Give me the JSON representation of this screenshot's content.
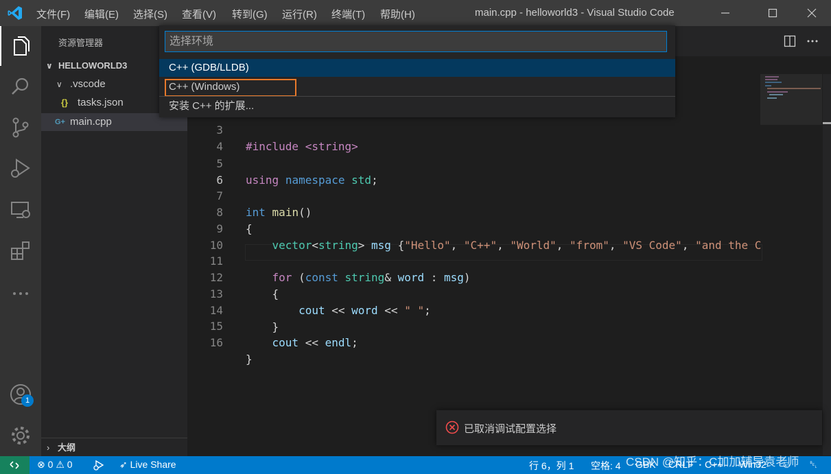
{
  "window": {
    "title": "main.cpp - helloworld3 - Visual Studio Code"
  },
  "menu": [
    {
      "label": "文件(F)"
    },
    {
      "label": "编辑(E)"
    },
    {
      "label": "选择(S)"
    },
    {
      "label": "查看(V)"
    },
    {
      "label": "转到(G)"
    },
    {
      "label": "运行(R)"
    },
    {
      "label": "终端(T)"
    },
    {
      "label": "帮助(H)"
    }
  ],
  "activity_bar": {
    "items": [
      "explorer-icon",
      "search-icon",
      "source-control-icon",
      "run-debug-icon",
      "remote-explorer-icon",
      "extensions-icon",
      "more-icon"
    ],
    "bottom": [
      "account-icon",
      "gear-icon"
    ],
    "account_badge": "1"
  },
  "sidebar": {
    "title": "资源管理器",
    "folder": "HELLOWORLD3",
    "items": [
      {
        "label": ".vscode",
        "icon": "chevron-down-icon"
      },
      {
        "label": "tasks.json",
        "icon": "json-braces-icon",
        "badge": "{}"
      },
      {
        "label": "main.cpp",
        "icon": "cpp-file-icon",
        "badge": "G+"
      }
    ],
    "outline": "大纲"
  },
  "quickpick": {
    "placeholder": "选择环境",
    "items": [
      {
        "label": "C++ (GDB/LLDB)"
      },
      {
        "label": "C++ (Windows)"
      },
      {
        "label": "安装 C++ 的扩展..."
      }
    ]
  },
  "editor": {
    "partial_line": {
      "num": "3",
      "text": "#include <string>"
    },
    "lines": [
      {
        "num": "4"
      },
      {
        "num": "5"
      },
      {
        "num": "6"
      },
      {
        "num": "7"
      },
      {
        "num": "8"
      },
      {
        "num": "9"
      },
      {
        "num": "10"
      },
      {
        "num": "11"
      },
      {
        "num": "12"
      },
      {
        "num": "13"
      },
      {
        "num": "14"
      },
      {
        "num": "15"
      },
      {
        "num": "16"
      }
    ],
    "code": {
      "l5_using": "using",
      "l5_namespace": "namespace",
      "l5_std": "std",
      "l7_int": "int",
      "l7_main": "main",
      "l9_vector": "vector",
      "l9_string": "string",
      "l9_msg": "msg",
      "l9_s1": "\"Hello\"",
      "l9_s2": "\"C++\"",
      "l9_s3": "\"World\"",
      "l9_s4": "\"from\"",
      "l9_s5": "\"VS Code\"",
      "l9_s6": "\"and the C",
      "l11_for": "for",
      "l11_const": "const",
      "l11_string": "string",
      "l11_word": "word",
      "l11_msg": "msg",
      "l13_cout": "cout",
      "l13_word": "word",
      "l13_str": "\" \"",
      "l15_cout": "cout",
      "l15_endl": "endl"
    }
  },
  "notification": {
    "icon": "error-icon",
    "text": "已取消调试配置选择"
  },
  "statusbar": {
    "errors": "0",
    "warnings": "0",
    "live_share": "Live Share",
    "position": "行 6，列 1",
    "indent": "空格: 4",
    "encoding": "GBK",
    "eol": "CRLF",
    "language": "C++",
    "platform": "Win32"
  },
  "watermark": "CSDN @知乎：C加加辅导袁老师",
  "colors": {
    "accent": "#007acc",
    "highlight_box": "#e8792b",
    "remote": "#16825d"
  }
}
